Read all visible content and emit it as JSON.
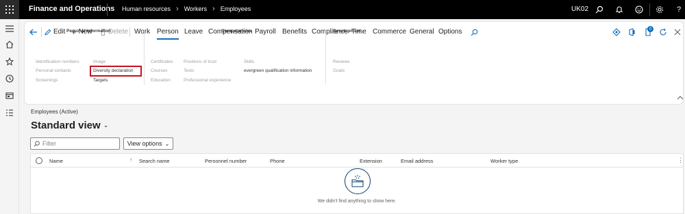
{
  "header": {
    "app_name": "Finance and Operations",
    "breadcrumbs": [
      "Human resources",
      "Workers",
      "Employees"
    ],
    "company": "UK02",
    "icons": [
      "waffle-icon",
      "search-icon",
      "bell-icon",
      "smiley-icon",
      "gear-icon",
      "help-icon"
    ]
  },
  "leftnav": {
    "icons": [
      "hamburger-icon",
      "home-icon",
      "favorites-icon",
      "recent-icon",
      "workspaces-icon",
      "modules-icon"
    ]
  },
  "actionpane": {
    "edit_label": "Edit",
    "new_label": "New",
    "delete_label": "Delete",
    "tabs": [
      "Work",
      "Person",
      "Leave",
      "Compensation",
      "Payroll",
      "Benefits",
      "Compliance",
      "Time",
      "Commerce",
      "General",
      "Options"
    ],
    "active_tab": "Person",
    "notification_count": "0",
    "groups": {
      "personal_information": {
        "title": "Personal information",
        "col1": [
          "Identification numbers",
          "Personal contacts",
          "Screenings"
        ],
        "col2": [
          "Image",
          "Diversity declaration",
          "Targets"
        ]
      },
      "competencies": {
        "title": "Competencies",
        "col1": [
          "Certificates",
          "Courses",
          "Education"
        ],
        "col2": [
          "Positions of trust",
          "Tests",
          "Professional experience"
        ],
        "col3": [
          "Skills",
          "evergreen qualification information"
        ]
      },
      "development": {
        "title": "Development",
        "col1": [
          "Reviews",
          "Goals"
        ]
      }
    }
  },
  "main": {
    "caption": "Employees (Active)",
    "view_title": "Standard view",
    "filter_placeholder": "Filter",
    "view_options_label": "View options",
    "columns": [
      "Name",
      "Search name",
      "Personnel number",
      "Phone",
      "Extension",
      "Email address",
      "Worker type"
    ],
    "empty_message": "We didn't find anything to show here."
  },
  "colors": {
    "accent": "#0f6cbd",
    "highlight_border": "#c50f1f",
    "topbar": "#000000"
  }
}
